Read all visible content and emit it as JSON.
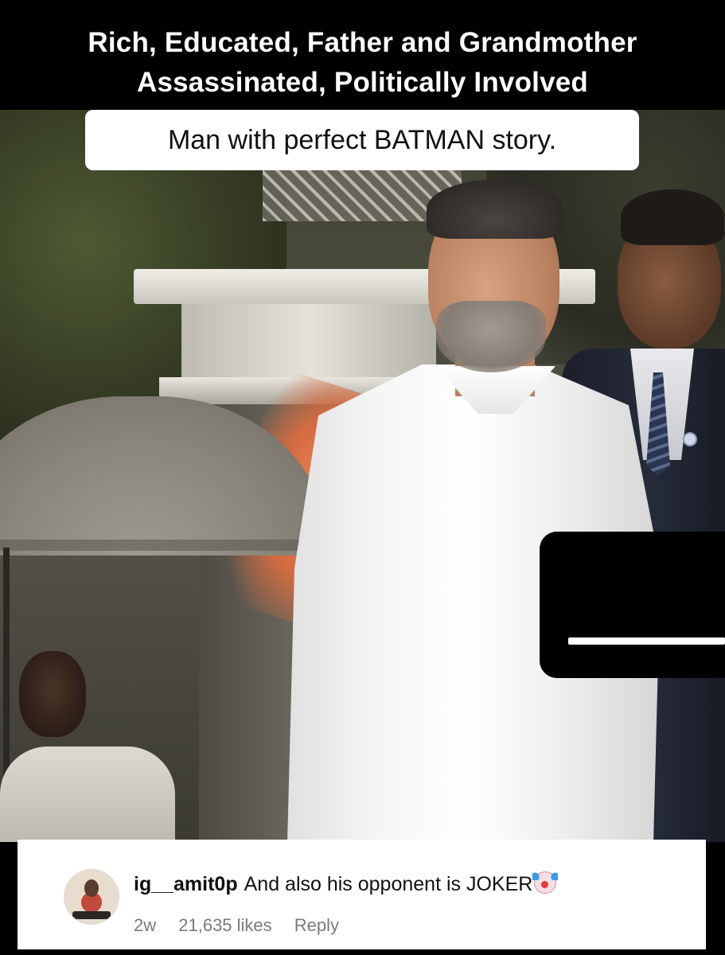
{
  "caption": {
    "line1": "Rich, Educated, Father and Grandmother",
    "line2": "Assassinated, Politically Involved",
    "overlay_text": "Man with perfect BATMAN story."
  },
  "comment": {
    "username": "ig__amit0p",
    "text": "And also his opponent is JOKER",
    "emoji_icon": "clown-face-icon",
    "time": "2w",
    "likes": "21,635 likes",
    "reply_label": "Reply"
  },
  "colors": {
    "caption_band": "#000000",
    "caption_text": "#ffffff",
    "overlay_box": "#ffffff",
    "comment_meta": "#7a7a7a"
  }
}
